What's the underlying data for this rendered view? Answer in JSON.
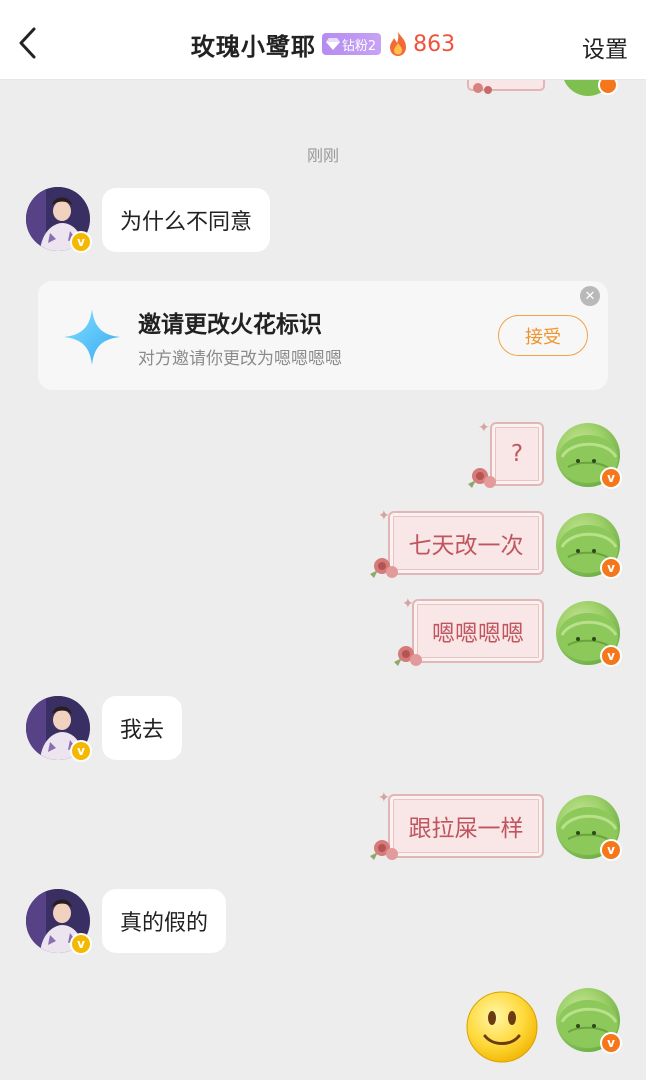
{
  "header": {
    "title": "玫瑰小鹭耶",
    "fan_badge": "钻粉2",
    "fire_count": "863",
    "settings_label": "设置"
  },
  "timestamp": "刚刚",
  "invite": {
    "title": "邀请更改火花标识",
    "subtitle": "对方邀请你更改为嗯嗯嗯嗯",
    "accept_label": "接受",
    "close_symbol": "✕"
  },
  "messages": [
    {
      "side": "left",
      "text": "为什么不同意"
    },
    {
      "side": "right",
      "text": "?"
    },
    {
      "side": "right",
      "text": "七天改一次"
    },
    {
      "side": "right",
      "text": "嗯嗯嗯嗯"
    },
    {
      "side": "left",
      "text": "我去"
    },
    {
      "side": "right",
      "text": "跟拉屎一样"
    },
    {
      "side": "left",
      "text": "真的假的"
    },
    {
      "side": "right",
      "sticker": "smiley-face"
    }
  ],
  "badge": {
    "verified_symbol": "v"
  },
  "colors": {
    "accent_orange": "#f0932a",
    "fire_red": "#f0533a",
    "rose_text": "#c0555f",
    "fan_purple": "#b48cf0"
  },
  "icons": [
    "back-chevron-icon",
    "diamond-icon",
    "fire-icon",
    "spark-star-icon",
    "close-icon",
    "rose-icon",
    "sparkle-icon",
    "smiley-icon"
  ]
}
